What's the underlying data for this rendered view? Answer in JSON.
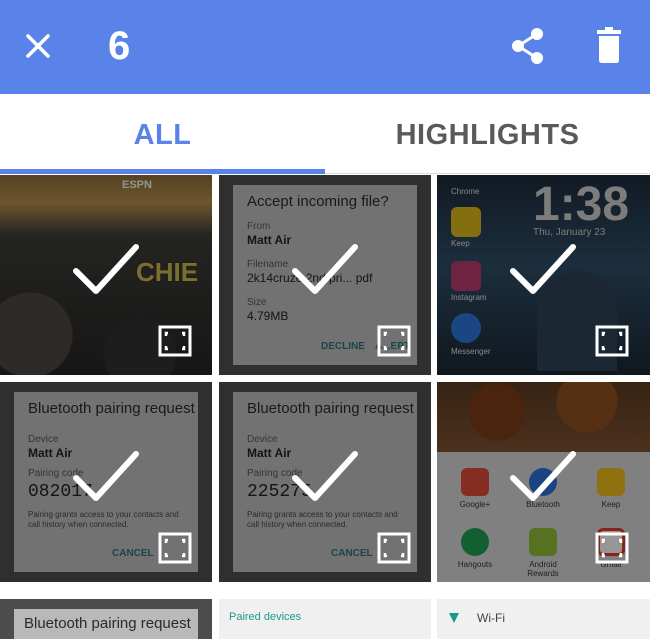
{
  "header": {
    "selected_count": "6",
    "icons": {
      "close": "close-icon",
      "share": "share-icon",
      "delete": "trash-icon"
    }
  },
  "tabs": [
    {
      "label": "ALL",
      "selected": true
    },
    {
      "label": "HIGHLIGHTS",
      "selected": false
    }
  ],
  "colors": {
    "accent": "#5a83ea",
    "tab_inactive": "#5a5a5a",
    "on_accent": "#ffffff"
  },
  "grid": {
    "tiles": [
      {
        "kind": "photo",
        "watermark": "ESPN",
        "caption": "CHIE",
        "selected": true
      },
      {
        "kind": "file-dialog",
        "title": "Accept incoming file?",
        "from_label": "From",
        "from_value": "Matt Air",
        "filename_label": "Filename",
        "filename_value": "2k14cruze 2nd pri... pdf",
        "size_label": "Size",
        "size_value": "4.79MB",
        "decline_label": "DECLINE",
        "accept_label": "A...EPT",
        "selected": true
      },
      {
        "kind": "lock-screen",
        "time": "1:38",
        "date": "Thu, January 23",
        "app_labels": [
          "Chrome",
          "Keep",
          "Instagram",
          "Messenger"
        ],
        "selected": true
      },
      {
        "kind": "pairing-dialog",
        "title": "Bluetooth pairing request",
        "device_label": "Device",
        "device_value": "Matt Air",
        "code_label": "Pairing code",
        "code_value": "082017",
        "note": "Pairing grants access to your contacts and call history when connected.",
        "cancel_label": "CANCEL",
        "selected": true
      },
      {
        "kind": "pairing-dialog",
        "title": "Bluetooth pairing request",
        "device_label": "Device",
        "device_value": "Matt Air",
        "code_label": "Pairing code",
        "code_value": "225275",
        "note": "Pairing grants access to your contacts and call history when connected.",
        "cancel_label": "CANCEL",
        "selected": true
      },
      {
        "kind": "app-drawer",
        "apps": [
          "Google+",
          "Bluetooth",
          "Keep",
          "Hangouts",
          "Android Rewards",
          "Gmail"
        ],
        "selected": true
      }
    ],
    "partial_row": [
      {
        "text": "Bluetooth pairing request"
      },
      {
        "text": "Paired devices"
      },
      {
        "text": "Wi-Fi"
      }
    ]
  }
}
